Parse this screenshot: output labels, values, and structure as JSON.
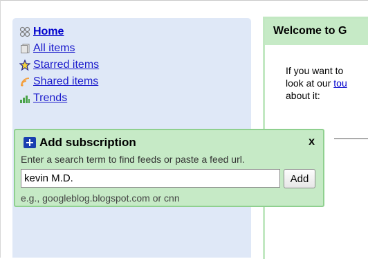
{
  "nav": {
    "items": [
      {
        "label": "Home",
        "icon": "home-icon"
      },
      {
        "label": "All items",
        "icon": "all-items-icon"
      },
      {
        "label": "Starred items",
        "icon": "star-icon"
      },
      {
        "label": "Shared items",
        "icon": "shared-icon"
      },
      {
        "label": "Trends",
        "icon": "trends-icon"
      }
    ]
  },
  "subscription": {
    "title": "Add subscription",
    "close_label": "x",
    "help_text": "Enter a search term to find feeds or paste a feed url.",
    "input_value": "kevin M.D.",
    "add_label": "Add",
    "example_text": "e.g., googleblog.blogspot.com or cnn"
  },
  "welcome": {
    "header": "Welcome to G",
    "line1": "If you want to",
    "line2_prefix": "look at our ",
    "line2_link": "tou",
    "line3": "about it:"
  },
  "colors": {
    "nav_bg": "#dfe8f7",
    "popup_bg": "#c6eac6",
    "link": "#0000cc",
    "accent_green": "#8fd08f"
  }
}
